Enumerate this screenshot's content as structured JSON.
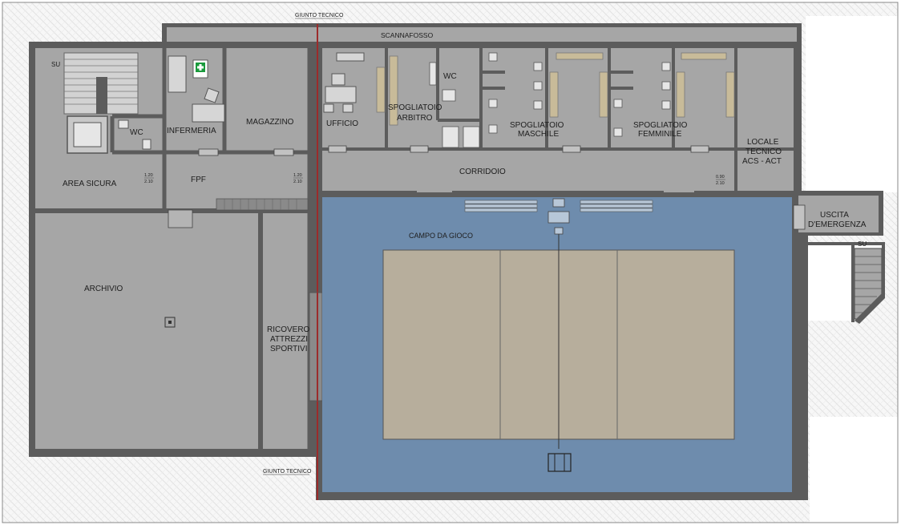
{
  "labels": {
    "giunto_top": "GIUNTO TECNICO",
    "giunto_bottom": "GIUNTO TECNICO",
    "scannafosso": "SCANNAFOSSO",
    "su_left": "SU",
    "su_right": "SU",
    "wc_left": "WC",
    "infermeria": "INFERMERIA",
    "magazzino": "MAGAZZINO",
    "ufficio": "UFFICIO",
    "wc_right": "WC",
    "spogliatoio_arbitro_1": "SPOGLIATOIO",
    "spogliatoio_arbitro_2": "ARBITRO",
    "spogliatoio_maschile_1": "SPOGLIATOIO",
    "spogliatoio_maschile_2": "MASCHILE",
    "spogliatoio_femminile_1": "SPOGLIATOIO",
    "spogliatoio_femminile_2": "FEMMINILE",
    "locale_tecnico_1": "LOCALE",
    "locale_tecnico_2": "TECNICO",
    "locale_tecnico_3": "ACS - ACT",
    "area_sicura": "AREA SICURA",
    "fpf": "FPF",
    "corridoio": "CORRIDOIO",
    "uscita_1": "USCITA",
    "uscita_2": "D'EMERGENZA",
    "campo_da_gioco": "CAMPO DA GIOCO",
    "archivio": "ARCHIVIO",
    "ricovero_1": "RICOVERO",
    "ricovero_2": "ATTREZZI",
    "ricovero_3": "SPORTIVI"
  },
  "door_dims": {
    "d1_top": "1.20",
    "d1_bot": "2.10",
    "d2_top": "1.20",
    "d2_bot": "2.10",
    "d3_top": "0.90",
    "d3_bot": "2.10"
  },
  "colors": {
    "room_fill": "#a6a6a6",
    "wall": "#5c5c5c",
    "court_fill": "#6e8cad",
    "playing_area": "#b7ae9c",
    "joint_line": "#9c2b2b",
    "first_aid": "#1a9a3c"
  },
  "icons": {
    "first_aid_sign": "first-aid-cross-icon"
  }
}
